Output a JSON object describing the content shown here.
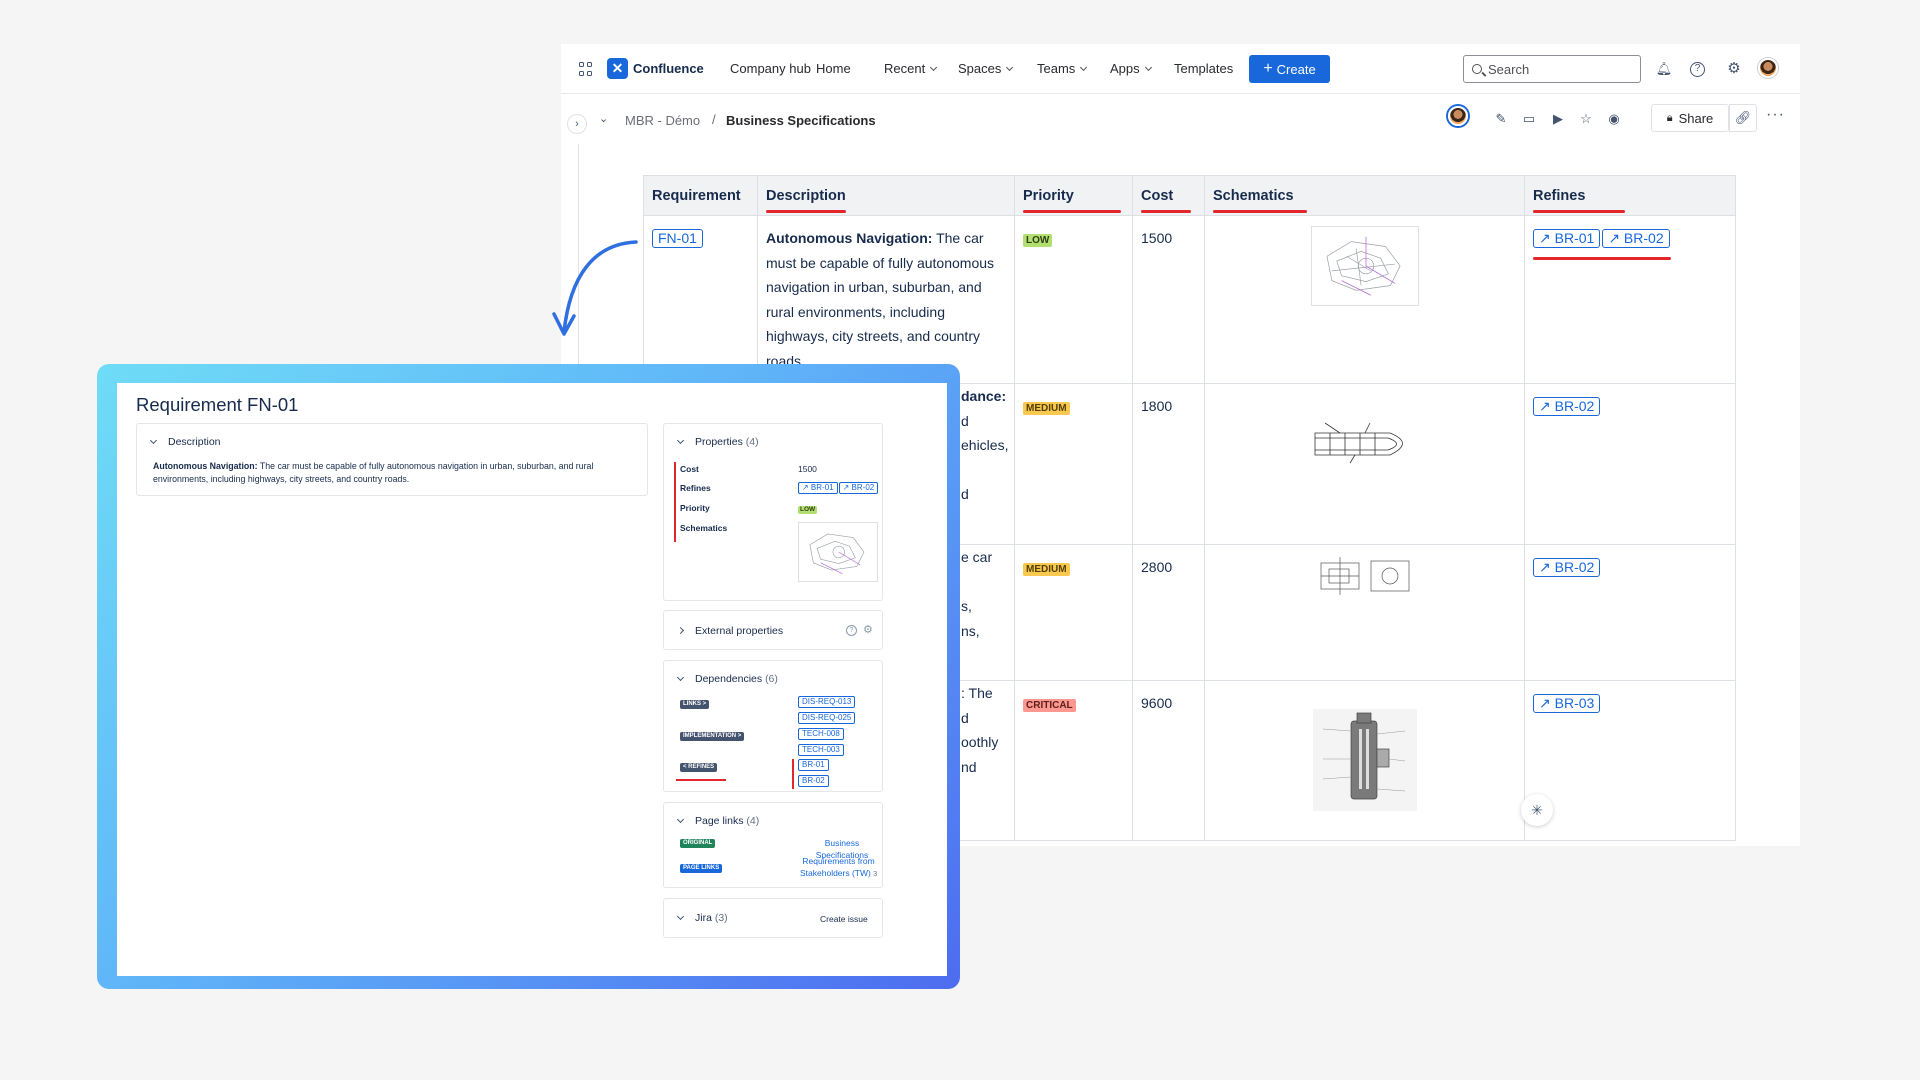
{
  "nav": {
    "brand": "Confluence",
    "items": [
      "Company hub",
      "Home",
      "Recent",
      "Spaces",
      "Teams",
      "Apps",
      "Templates"
    ],
    "create_label": "Create",
    "search_placeholder": "Search"
  },
  "breadcrumb": {
    "space": "MBR - Démo",
    "separator": "/",
    "page": "Business Specifications"
  },
  "toolbar": {
    "share_label": "Share"
  },
  "table": {
    "headers": [
      "Requirement",
      "Description",
      "Priority",
      "Cost",
      "Schematics",
      "Refines"
    ],
    "rows": [
      {
        "req": "FN-01",
        "desc_bold": "Autonomous Navigation:",
        "desc": "The car must be capable of fully autonomous navigation in urban, suburban, and rural environments, including highways, city streets, and country roads.",
        "priority": "LOW",
        "cost": "1500",
        "refines": [
          "↗ BR-01",
          "↗ BR-02"
        ]
      },
      {
        "desc_fragment": "dance:",
        "desc_lines": [
          "d",
          "ehicles,",
          "",
          "d"
        ],
        "priority": "MEDIUM",
        "cost": "1800",
        "refines": [
          "↗ BR-02"
        ]
      },
      {
        "desc_lines": [
          "e car",
          "",
          "s,",
          "ns,"
        ],
        "priority": "MEDIUM",
        "cost": "2800",
        "refines": [
          "↗ BR-02"
        ]
      },
      {
        "desc_lines": [
          ": The",
          "d",
          "oothly",
          "nd"
        ],
        "priority": "CRITICAL",
        "cost": "9600",
        "refines": [
          "↗ BR-03"
        ]
      }
    ]
  },
  "panel": {
    "title": "Requirement FN-01",
    "description": {
      "heading": "Description",
      "bold": "Autonomous Navigation:",
      "text": "The car must be capable of fully autonomous navigation in urban, suburban, and rural environments, including highways, city streets, and country roads."
    },
    "properties": {
      "heading": "Properties",
      "count": "(4)",
      "cost_label": "Cost",
      "cost": "1500",
      "refines_label": "Refines",
      "refines": [
        "↗ BR-01",
        "↗ BR-02"
      ],
      "priority_label": "Priority",
      "priority": "LOW",
      "schematics_label": "Schematics"
    },
    "external": {
      "heading": "External properties"
    },
    "dependencies": {
      "heading": "Dependencies",
      "count": "(6)",
      "links_label": "LINKS >",
      "impl_label": "IMPLEMENTATION >",
      "refines_label": "< REFINES",
      "tags": [
        "DIS-REQ-013",
        "DIS-REQ-025",
        "TECH-008",
        "TECH-003",
        "BR-01",
        "BR-02"
      ]
    },
    "page_links": {
      "heading": "Page links",
      "count": "(4)",
      "original_label": "ORIGINAL",
      "page_links_label": "PAGE LINKS",
      "original_link": "Business Specifications",
      "link2_line1": "Requirements from",
      "link2_line2": "Stakeholders (TW)",
      "link2_count": "3"
    },
    "jira": {
      "heading": "Jira",
      "count": "(3)",
      "action": "Create issue"
    }
  },
  "colors": {
    "brand_blue": "#1868db",
    "accent_red": "#e2262b",
    "low": "#b3df72",
    "medium": "#f9c84e",
    "critical": "#fd9891"
  }
}
